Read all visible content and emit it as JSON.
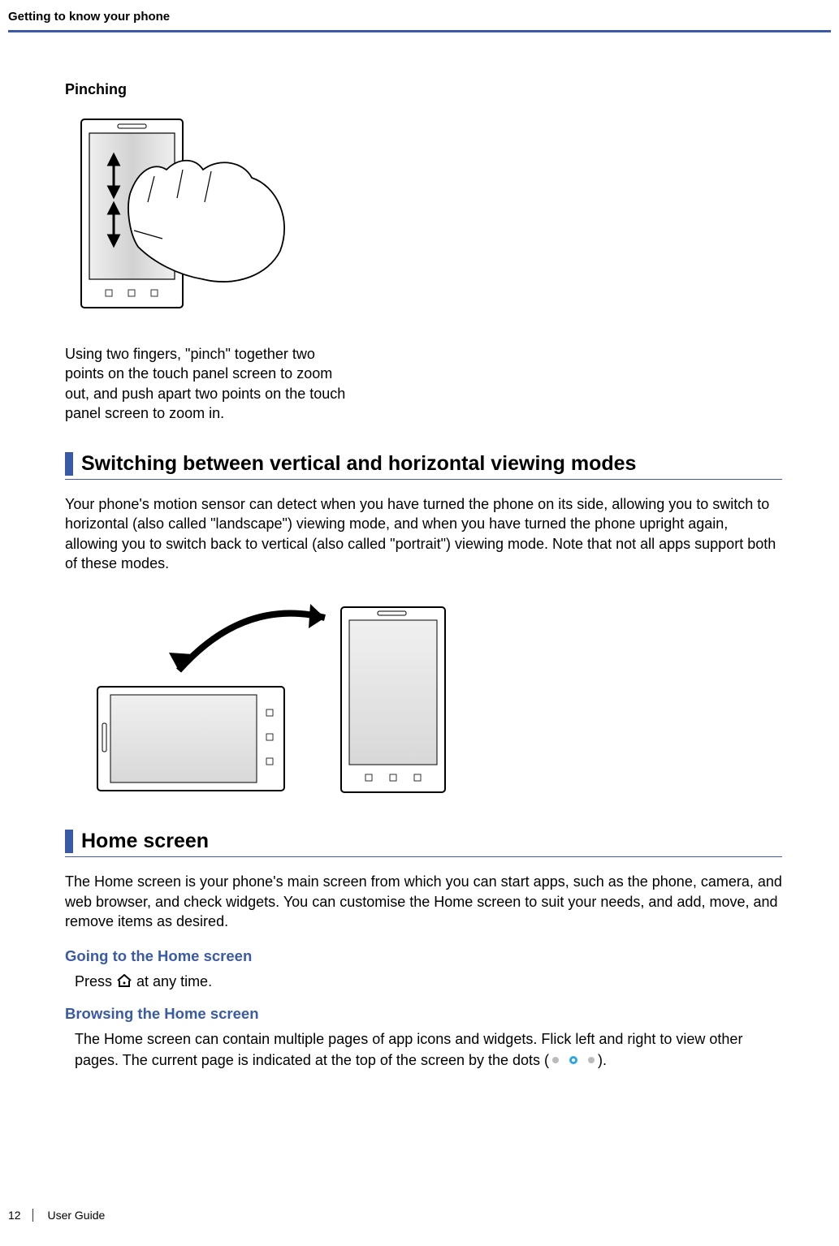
{
  "header": {
    "running_title": "Getting to know your phone"
  },
  "pinching": {
    "label": "Pinching",
    "caption": "Using two fingers, \"pinch\" together two points on the touch panel screen to zoom out, and push apart two points on the touch panel screen to zoom in."
  },
  "switching": {
    "heading": "Switching between vertical and horizontal viewing modes",
    "body": "Your phone's motion sensor can detect when you have turned the phone on its side, allowing you to switch to horizontal (also called \"landscape\") viewing mode, and when you have turned the phone upright again, allowing you to switch back to vertical (also called \"portrait\") viewing mode. Note that not all apps support both of these modes."
  },
  "home": {
    "heading": "Home screen",
    "intro": "The Home screen is your phone's main screen from which you can start apps, such as the phone, camera, and web browser, and check widgets. You can customise the Home screen to suit your needs, and add, move, and remove items as desired.",
    "going_heading": "Going to the Home screen",
    "going_text_prefix": "Press ",
    "going_text_suffix": " at any time.",
    "browsing_heading": "Browsing the Home screen",
    "browsing_text_prefix": "The Home screen can contain multiple pages of app icons and widgets. Flick left and right to view other pages. The current page is indicated at the top of the screen by the dots (",
    "browsing_text_suffix": ")."
  },
  "footer": {
    "page_number": "12",
    "guide_label": "User Guide"
  },
  "icons": {
    "home": "home-icon",
    "dots": "dots-indicator-icon"
  }
}
